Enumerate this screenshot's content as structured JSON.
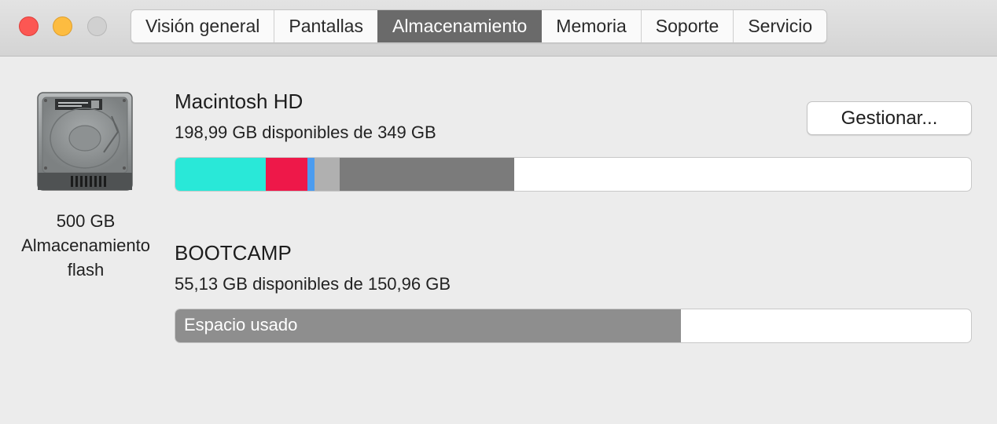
{
  "window": {
    "controls": {
      "close_color": "#fc5753",
      "minimize_color": "#fdbc40",
      "maximize_color": "#d0d0d0"
    }
  },
  "tabs": [
    {
      "label": "Visión general",
      "active": false
    },
    {
      "label": "Pantallas",
      "active": false
    },
    {
      "label": "Almacenamiento",
      "active": true
    },
    {
      "label": "Memoria",
      "active": false
    },
    {
      "label": "Soporte",
      "active": false
    },
    {
      "label": "Servicio",
      "active": false
    }
  ],
  "drive": {
    "icon": "hard-drive-icon",
    "capacity": "500 GB",
    "type_line1": "Almacenamiento",
    "type_line2": "flash"
  },
  "volumes": [
    {
      "name": "Macintosh HD",
      "availability": "198,99 GB disponibles de 349 GB",
      "manage_label": "Gestionar...",
      "usage_segments": [
        {
          "name": "apps",
          "color": "#29e8d8",
          "fraction": 0.114
        },
        {
          "name": "documents",
          "color": "#ee1849",
          "fraction": 0.052
        },
        {
          "name": "mail",
          "color": "#4b9cf0",
          "fraction": 0.009
        },
        {
          "name": "other-light",
          "color": "#b0b0b0",
          "fraction": 0.032
        },
        {
          "name": "system",
          "color": "#7b7b7b",
          "fraction": 0.219
        }
      ]
    },
    {
      "name": "BOOTCAMP",
      "availability": "55,13 GB disponibles de 150,96 GB",
      "used_label": "Espacio usado",
      "usage_segments": [
        {
          "name": "used",
          "color": "#8e8e8e",
          "fraction": 0.635
        }
      ]
    }
  ]
}
